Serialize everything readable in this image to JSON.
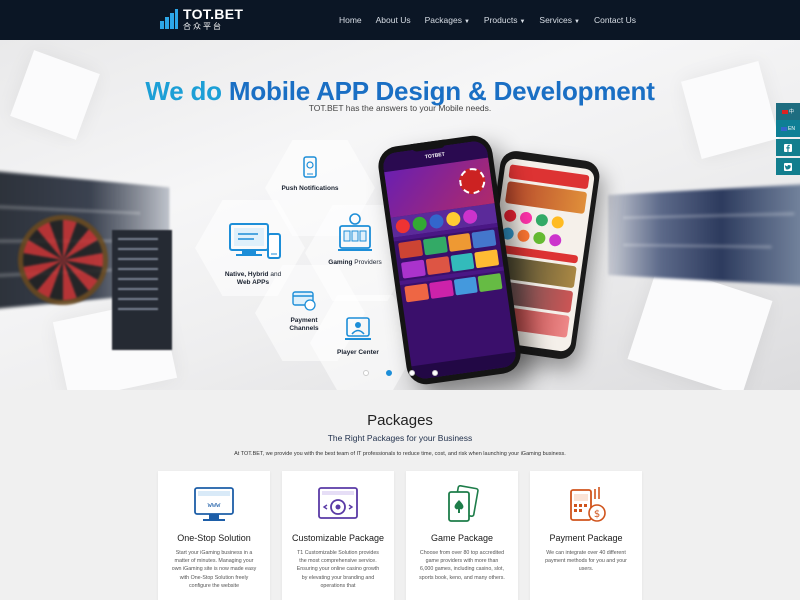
{
  "brand": {
    "name": "TOT.BET",
    "tagline": "合众平台",
    "accent": "#2da7e8",
    "nav_bg": "#0b1625"
  },
  "nav": {
    "items": [
      {
        "label": "Home",
        "dropdown": false
      },
      {
        "label": "About Us",
        "dropdown": false
      },
      {
        "label": "Packages",
        "dropdown": true
      },
      {
        "label": "Products",
        "dropdown": true
      },
      {
        "label": "Services",
        "dropdown": true
      },
      {
        "label": "Contact Us",
        "dropdown": false
      }
    ]
  },
  "hero": {
    "title": "We do Mobile APP Design & Development",
    "subtitle": "TOT.BET has the answers to your Mobile needs.",
    "features": [
      {
        "label": "Push Notifications",
        "icon": "push-notification-icon"
      },
      {
        "label_bold": "Native, Hybrid",
        "label_plain": " and",
        "label_line2": "Web APPs",
        "icon": "devices-icon"
      },
      {
        "label_bold": "Gaming",
        "label_plain": " Providers",
        "icon": "slot-machine-icon"
      },
      {
        "label": "Payment Channels",
        "icon": "payment-card-icon"
      },
      {
        "label": "Player Center",
        "icon": "player-center-icon"
      }
    ],
    "phone": {
      "brand": "TOTBET"
    },
    "slides": {
      "count": 4,
      "active": 2
    }
  },
  "social": {
    "lang_cn": "中",
    "lang_en": "EN",
    "facebook_icon": "facebook-icon",
    "twitter_icon": "twitter-icon"
  },
  "packages": {
    "title": "Packages",
    "subtitle": "The Right Packages for your Business",
    "description": "At TOT.BET, we provide you with the best team of IT professionals to reduce time, cost, and risk when launching your iGaming business.",
    "cards": [
      {
        "title": "One-Stop Solution",
        "icon": "website-icon",
        "text": "Start your iGaming business in a matter of minutes. Managing your own iGaming site is now made easy with One-Stop Solution freely configure the website"
      },
      {
        "title": "Customizable Package",
        "icon": "gear-code-icon",
        "text": "T1 Customizable Solution provides the most comprehensive service. Ensuring your online casino growth by elevating your branding and operations that"
      },
      {
        "title": "Game Package",
        "icon": "playing-cards-icon",
        "text": "Choose from over 80 top accredited game providers with more than 6,000 games, including casino, slot, sports book, keno, and many others."
      },
      {
        "title": "Payment Package",
        "icon": "payment-terminal-icon",
        "text": "We can integrate over 40 different payment methods for you and your users."
      }
    ]
  }
}
